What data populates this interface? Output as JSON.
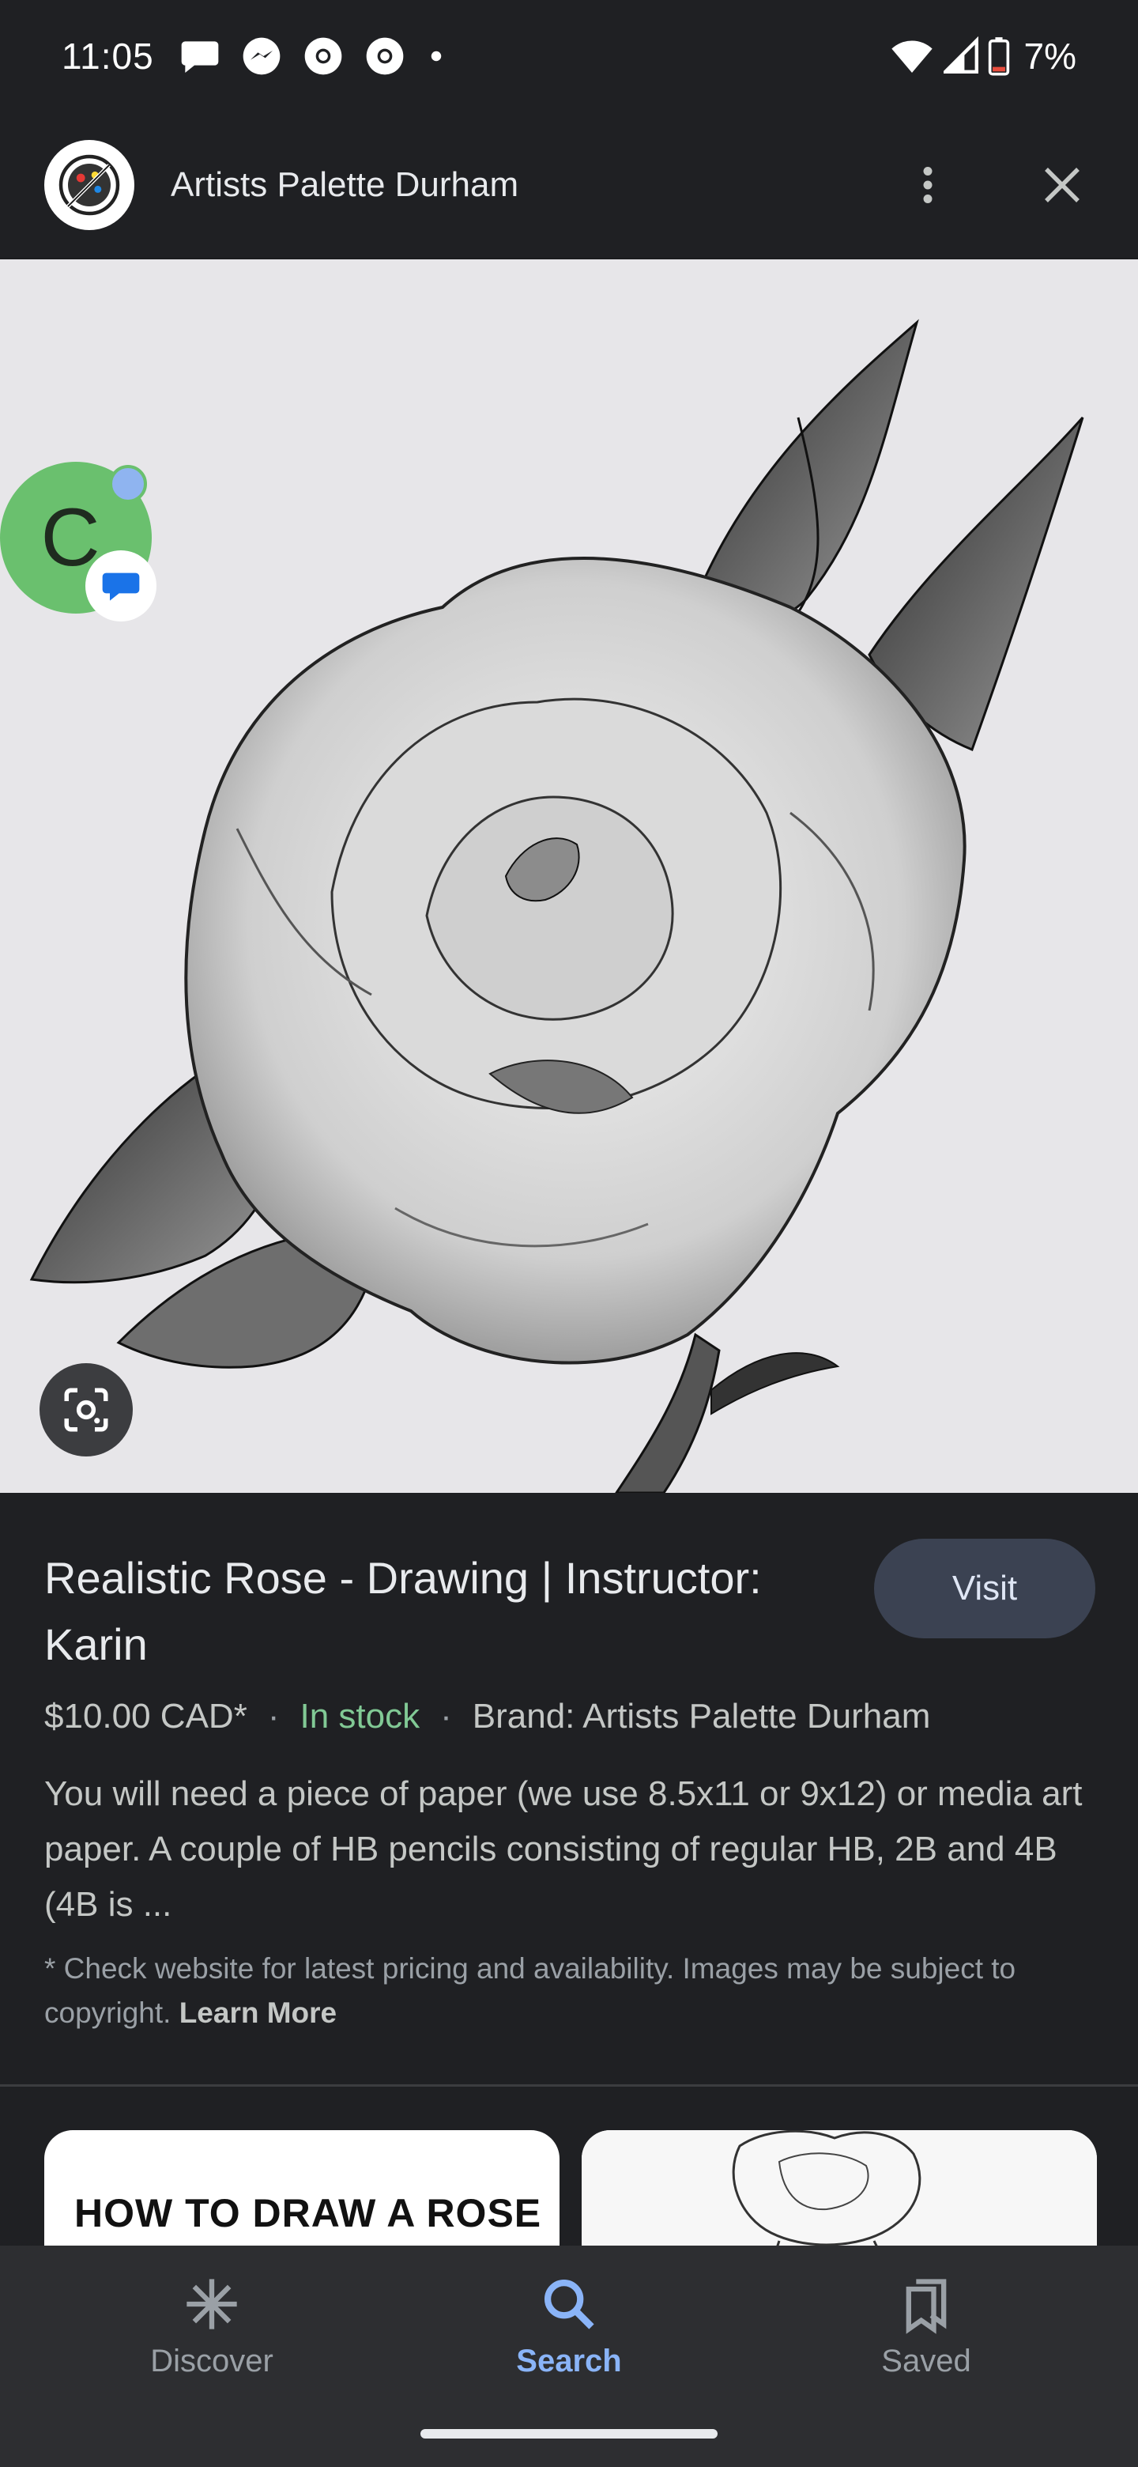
{
  "status_bar": {
    "time": "11:05",
    "battery": "7%"
  },
  "header": {
    "site_name": "Artists Palette Durham"
  },
  "chat_head": {
    "letter": "C"
  },
  "product": {
    "title": "Realistic Rose - Drawing | Instructor: Karin",
    "visit_label": "Visit",
    "price": "$10.00 CAD*",
    "availability": "In stock",
    "brand": "Brand: Artists Palette Durham",
    "separator": "·",
    "description": "You will need a piece of paper (we use 8.5x11 or 9x12) or media art paper. A couple of HB pencils consisting of regular HB, 2B and 4B (4B is ...",
    "disclaimer": "* Check website for latest pricing and availability. Images may be subject to copyright.",
    "learn_more": "Learn More"
  },
  "related": {
    "card1_title": "HOW TO DRAW A ROSE"
  },
  "bottom_nav": {
    "discover": "Discover",
    "search": "Search",
    "saved": "Saved"
  },
  "colors": {
    "background": "#1f2023",
    "accent": "#8ab4f8",
    "in_stock": "#81c995",
    "visit_button": "#3b4252"
  }
}
